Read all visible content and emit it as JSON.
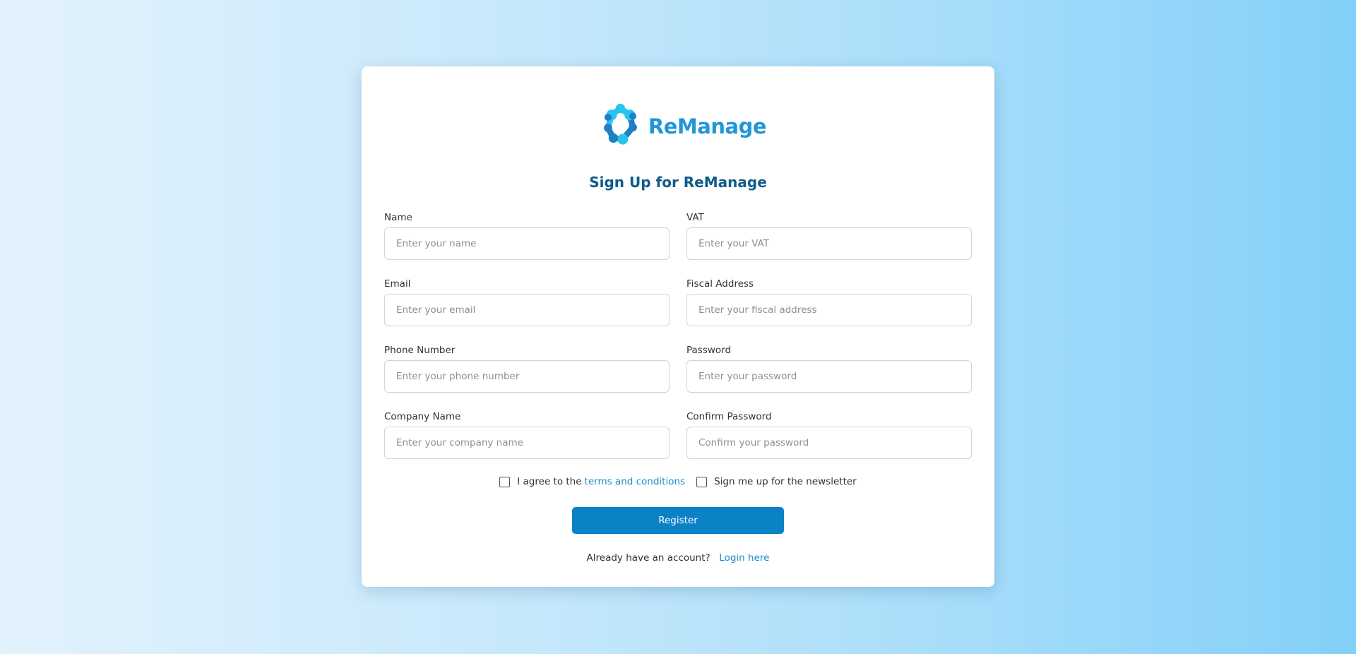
{
  "brand": {
    "name": "ReManage",
    "colors": {
      "accent": "#0a82c5",
      "title": "#0d5c8a",
      "link": "#1a8ccb",
      "logo_light": "#29c3ee",
      "logo_dark": "#1e7fc4"
    },
    "logo_icon": "molecule-ring-icon"
  },
  "form": {
    "title": "Sign Up for ReManage",
    "fields": {
      "name": {
        "label": "Name",
        "placeholder": "Enter your name",
        "value": ""
      },
      "vat": {
        "label": "VAT",
        "placeholder": "Enter your VAT",
        "value": ""
      },
      "email": {
        "label": "Email",
        "placeholder": "Enter your email",
        "value": ""
      },
      "fiscal_address": {
        "label": "Fiscal Address",
        "placeholder": "Enter your fiscal address",
        "value": ""
      },
      "phone": {
        "label": "Phone Number",
        "placeholder": "Enter your phone number",
        "value": ""
      },
      "password": {
        "label": "Password",
        "placeholder": "Enter your password",
        "value": ""
      },
      "company": {
        "label": "Company Name",
        "placeholder": "Enter your company name",
        "value": ""
      },
      "confirm_password": {
        "label": "Confirm Password",
        "placeholder": "Confirm your password",
        "value": ""
      }
    },
    "terms": {
      "prefix": "I agree to the",
      "link": "terms and conditions",
      "checked": false
    },
    "newsletter": {
      "label": "Sign me up for the newsletter",
      "checked": false
    },
    "register_label": "Register",
    "login": {
      "prompt": "Already have an account?",
      "link": "Login here"
    }
  }
}
